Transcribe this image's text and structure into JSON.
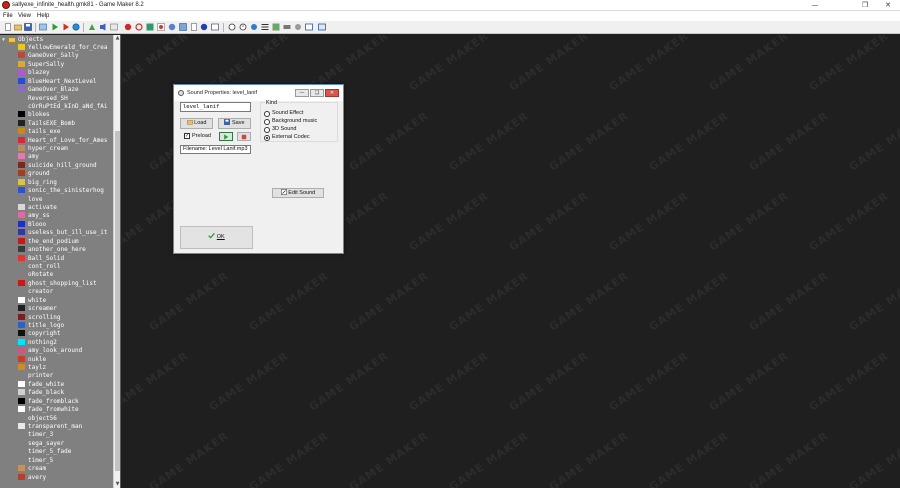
{
  "window": {
    "title": "sallyexe_infinite_health.gmk81 - Game Maker 8.2",
    "minimize": "—",
    "maximize": "❐",
    "close": "✕"
  },
  "menu": [
    "File",
    "View",
    "Help"
  ],
  "tree": {
    "root_label": "Objects",
    "items": [
      {
        "label": "YellowEmerald_for_Crea",
        "icon": "#e8c81a"
      },
      {
        "label": "GameOver_Sally",
        "icon": "#b94b3a"
      },
      {
        "label": "SuperSally",
        "icon": "#d9a83b"
      },
      {
        "label": "blazey",
        "icon": "#b05acb"
      },
      {
        "label": "BlueHeart_NextLevel",
        "icon": "#2a4bd8"
      },
      {
        "label": "GameOver_Blaze",
        "icon": "#8a6cc2"
      },
      {
        "label": "Reversed_SH",
        "icon": ""
      },
      {
        "label": "cOrRuPtEd_kInD_aNd_fAi",
        "icon": ""
      },
      {
        "label": "blokes",
        "icon": "#000000"
      },
      {
        "label": "TailsEXE_Bomb",
        "icon": "#222222"
      },
      {
        "label": "tails_exe",
        "icon": "#c88a1b"
      },
      {
        "label": "Heart_of_Love_for_Ames",
        "icon": "#d22b3f"
      },
      {
        "label": "hyper_cream",
        "icon": "#b98e62"
      },
      {
        "label": "amy",
        "icon": "#e47bb0"
      },
      {
        "label": "suicide_hill_ground",
        "icon": "#7a2a1d"
      },
      {
        "label": "ground",
        "icon": "#a0401e"
      },
      {
        "label": "big_ring",
        "icon": "#d8c44a"
      },
      {
        "label": "sonic_the_sinisterhog",
        "icon": "#2c55c9"
      },
      {
        "label": "love",
        "icon": ""
      },
      {
        "label": "activate",
        "icon": "#d8d8d8"
      },
      {
        "label": "amy_ss",
        "icon": "#e06aa6"
      },
      {
        "label": "Blooo",
        "icon": "#1d2fc4"
      },
      {
        "label": "useless_but_ill_use_it",
        "icon": "#333a9c"
      },
      {
        "label": "the_end_podium",
        "icon": "#c41a1a"
      },
      {
        "label": "another_one_here",
        "icon": "#3b3b3b"
      },
      {
        "label": "Ball_Solid",
        "icon": "#e03434"
      },
      {
        "label": "cont_roll",
        "icon": ""
      },
      {
        "label": "oRotate",
        "icon": ""
      },
      {
        "label": "ghost_shopping_list",
        "icon": "#c41a1a"
      },
      {
        "label": "creator",
        "icon": ""
      },
      {
        "label": "white",
        "icon": "#ffffff"
      },
      {
        "label": "screamer",
        "icon": "#202020"
      },
      {
        "label": "scrolling",
        "icon": "#7a1e1e"
      },
      {
        "label": "title_logo",
        "icon": "#3060c0"
      },
      {
        "label": "copyright",
        "icon": "#111111"
      },
      {
        "label": "nothing2",
        "icon": "#00e5ff"
      },
      {
        "label": "amy_look_around",
        "icon": "#d0577e"
      },
      {
        "label": "nukle",
        "icon": "#c83c2c"
      },
      {
        "label": "taylz",
        "icon": "#d08a2a"
      },
      {
        "label": "printer",
        "icon": ""
      },
      {
        "label": "fade_white",
        "icon": "#ffffff"
      },
      {
        "label": "fade_black",
        "icon": "#cfcfcf"
      },
      {
        "label": "fade_fromblack",
        "icon": "#000000"
      },
      {
        "label": "fade_fromwhite",
        "icon": "#ffffff"
      },
      {
        "label": "object56",
        "icon": ""
      },
      {
        "label": "transparent_man",
        "icon": "#e8e8e8"
      },
      {
        "label": "timer_3",
        "icon": ""
      },
      {
        "label": "sega_sayer",
        "icon": ""
      },
      {
        "label": "timer_5_fade",
        "icon": ""
      },
      {
        "label": "timer_5",
        "icon": ""
      },
      {
        "label": "cream",
        "icon": "#c79255"
      },
      {
        "label": "avery",
        "icon": "#b04030"
      }
    ]
  },
  "workspace": {
    "watermark": "GAME MAKER"
  },
  "dialog": {
    "title": "Sound Properties: level_lanif",
    "name_value": "level_lanif",
    "load_label": "Load",
    "save_label": "Save",
    "preload_label": "Preload",
    "preload_checked": true,
    "filename_label": "Filename: Level Lanif.mp3",
    "kind_label": "Kind",
    "kind_options": [
      "Sound Effect",
      "Background music",
      "3D Sound",
      "External Codec"
    ],
    "kind_selected": "External Codec",
    "edit_sound_label": "Edit Sound",
    "ok_label": "OK"
  }
}
